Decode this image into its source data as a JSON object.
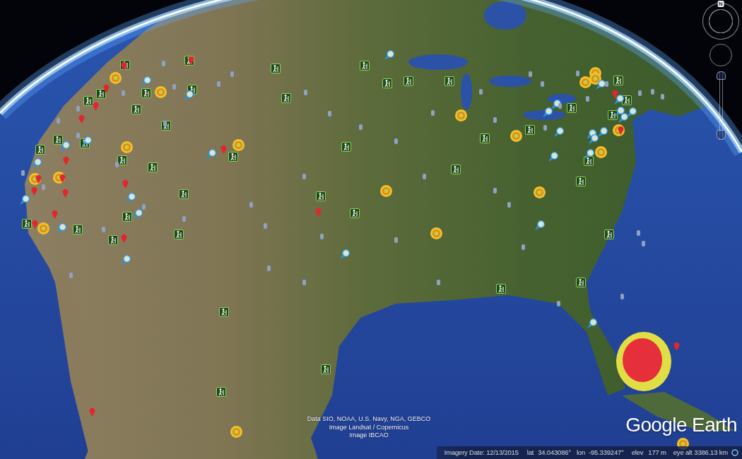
{
  "navigation": {
    "compass": {
      "label": "N"
    },
    "zoom_slider": {
      "level": 0
    }
  },
  "attribution": [
    "Data SIO, NOAA, U.S. Navy, NGA, GEBCO",
    "Image Landsat / Copernicus",
    "Image IBCAO"
  ],
  "logo": {
    "text": "Google Earth"
  },
  "status_bar": {
    "imagery_date": "Imagery Date: 12/13/2015",
    "lat_label": "lat",
    "lat": "34.043086°",
    "lon_label": "lon",
    "lon": "-95.339247°",
    "elev_label": "elev",
    "elev": "177 m",
    "eye_alt_label": "eye alt",
    "eye_alt": "3386.13 km"
  }
}
